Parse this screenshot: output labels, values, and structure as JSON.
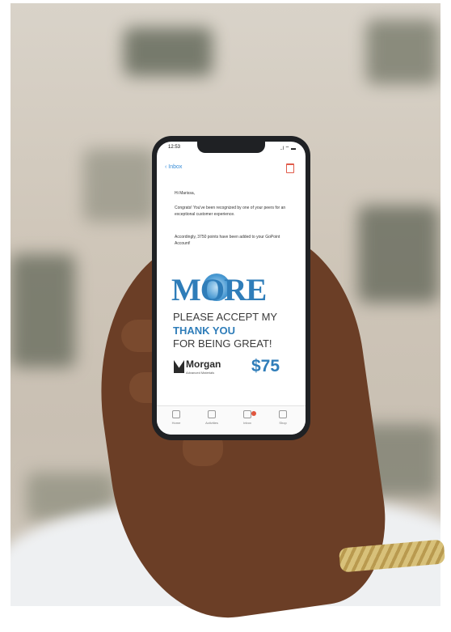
{
  "status": {
    "time": "12:53",
    "signal": "..l ⌔ ▬"
  },
  "nav": {
    "back_label": "Inbox"
  },
  "message": {
    "greeting": "Hi Marissa,",
    "para1": "Congrats! You've been recognized by one of your peers for an exceptional customer experience.",
    "para2": "Accordingly, 3750 points have been added to your GoPoint Account!"
  },
  "banner": {
    "logo": "MORE",
    "line1": "PLEASE ACCEPT MY",
    "line2": "THANK YOU",
    "line3": "FOR BEING GREAT!",
    "company": "Morgan",
    "company_sub": "Advanced Materials",
    "amount": "$75"
  },
  "tabs": [
    "Home",
    "Activities",
    "Inbox",
    "Shop"
  ],
  "colors": {
    "accent": "#2f7db9",
    "link": "#3a8ed8"
  }
}
